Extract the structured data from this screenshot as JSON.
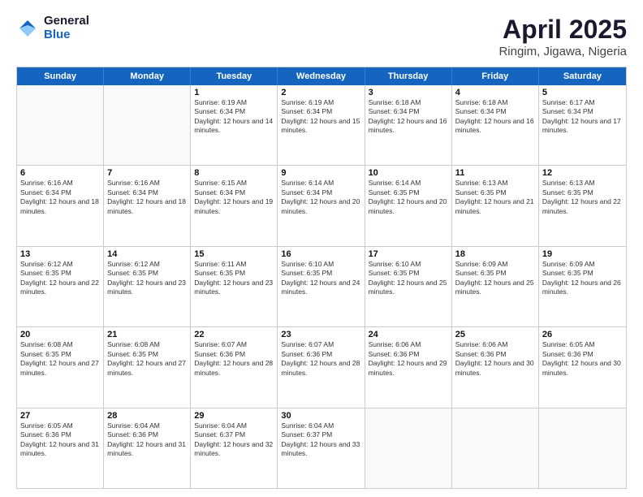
{
  "header": {
    "logo_general": "General",
    "logo_blue": "Blue",
    "title": "April 2025",
    "subtitle": "Ringim, Jigawa, Nigeria"
  },
  "days": [
    "Sunday",
    "Monday",
    "Tuesday",
    "Wednesday",
    "Thursday",
    "Friday",
    "Saturday"
  ],
  "weeks": [
    [
      {
        "day": "",
        "info": ""
      },
      {
        "day": "",
        "info": ""
      },
      {
        "day": "1",
        "info": "Sunrise: 6:19 AM\nSunset: 6:34 PM\nDaylight: 12 hours and 14 minutes."
      },
      {
        "day": "2",
        "info": "Sunrise: 6:19 AM\nSunset: 6:34 PM\nDaylight: 12 hours and 15 minutes."
      },
      {
        "day": "3",
        "info": "Sunrise: 6:18 AM\nSunset: 6:34 PM\nDaylight: 12 hours and 16 minutes."
      },
      {
        "day": "4",
        "info": "Sunrise: 6:18 AM\nSunset: 6:34 PM\nDaylight: 12 hours and 16 minutes."
      },
      {
        "day": "5",
        "info": "Sunrise: 6:17 AM\nSunset: 6:34 PM\nDaylight: 12 hours and 17 minutes."
      }
    ],
    [
      {
        "day": "6",
        "info": "Sunrise: 6:16 AM\nSunset: 6:34 PM\nDaylight: 12 hours and 18 minutes."
      },
      {
        "day": "7",
        "info": "Sunrise: 6:16 AM\nSunset: 6:34 PM\nDaylight: 12 hours and 18 minutes."
      },
      {
        "day": "8",
        "info": "Sunrise: 6:15 AM\nSunset: 6:34 PM\nDaylight: 12 hours and 19 minutes."
      },
      {
        "day": "9",
        "info": "Sunrise: 6:14 AM\nSunset: 6:34 PM\nDaylight: 12 hours and 20 minutes."
      },
      {
        "day": "10",
        "info": "Sunrise: 6:14 AM\nSunset: 6:35 PM\nDaylight: 12 hours and 20 minutes."
      },
      {
        "day": "11",
        "info": "Sunrise: 6:13 AM\nSunset: 6:35 PM\nDaylight: 12 hours and 21 minutes."
      },
      {
        "day": "12",
        "info": "Sunrise: 6:13 AM\nSunset: 6:35 PM\nDaylight: 12 hours and 22 minutes."
      }
    ],
    [
      {
        "day": "13",
        "info": "Sunrise: 6:12 AM\nSunset: 6:35 PM\nDaylight: 12 hours and 22 minutes."
      },
      {
        "day": "14",
        "info": "Sunrise: 6:12 AM\nSunset: 6:35 PM\nDaylight: 12 hours and 23 minutes."
      },
      {
        "day": "15",
        "info": "Sunrise: 6:11 AM\nSunset: 6:35 PM\nDaylight: 12 hours and 23 minutes."
      },
      {
        "day": "16",
        "info": "Sunrise: 6:10 AM\nSunset: 6:35 PM\nDaylight: 12 hours and 24 minutes."
      },
      {
        "day": "17",
        "info": "Sunrise: 6:10 AM\nSunset: 6:35 PM\nDaylight: 12 hours and 25 minutes."
      },
      {
        "day": "18",
        "info": "Sunrise: 6:09 AM\nSunset: 6:35 PM\nDaylight: 12 hours and 25 minutes."
      },
      {
        "day": "19",
        "info": "Sunrise: 6:09 AM\nSunset: 6:35 PM\nDaylight: 12 hours and 26 minutes."
      }
    ],
    [
      {
        "day": "20",
        "info": "Sunrise: 6:08 AM\nSunset: 6:35 PM\nDaylight: 12 hours and 27 minutes."
      },
      {
        "day": "21",
        "info": "Sunrise: 6:08 AM\nSunset: 6:35 PM\nDaylight: 12 hours and 27 minutes."
      },
      {
        "day": "22",
        "info": "Sunrise: 6:07 AM\nSunset: 6:36 PM\nDaylight: 12 hours and 28 minutes."
      },
      {
        "day": "23",
        "info": "Sunrise: 6:07 AM\nSunset: 6:36 PM\nDaylight: 12 hours and 28 minutes."
      },
      {
        "day": "24",
        "info": "Sunrise: 6:06 AM\nSunset: 6:36 PM\nDaylight: 12 hours and 29 minutes."
      },
      {
        "day": "25",
        "info": "Sunrise: 6:06 AM\nSunset: 6:36 PM\nDaylight: 12 hours and 30 minutes."
      },
      {
        "day": "26",
        "info": "Sunrise: 6:05 AM\nSunset: 6:36 PM\nDaylight: 12 hours and 30 minutes."
      }
    ],
    [
      {
        "day": "27",
        "info": "Sunrise: 6:05 AM\nSunset: 6:36 PM\nDaylight: 12 hours and 31 minutes."
      },
      {
        "day": "28",
        "info": "Sunrise: 6:04 AM\nSunset: 6:36 PM\nDaylight: 12 hours and 31 minutes."
      },
      {
        "day": "29",
        "info": "Sunrise: 6:04 AM\nSunset: 6:37 PM\nDaylight: 12 hours and 32 minutes."
      },
      {
        "day": "30",
        "info": "Sunrise: 6:04 AM\nSunset: 6:37 PM\nDaylight: 12 hours and 33 minutes."
      },
      {
        "day": "",
        "info": ""
      },
      {
        "day": "",
        "info": ""
      },
      {
        "day": "",
        "info": ""
      }
    ]
  ]
}
